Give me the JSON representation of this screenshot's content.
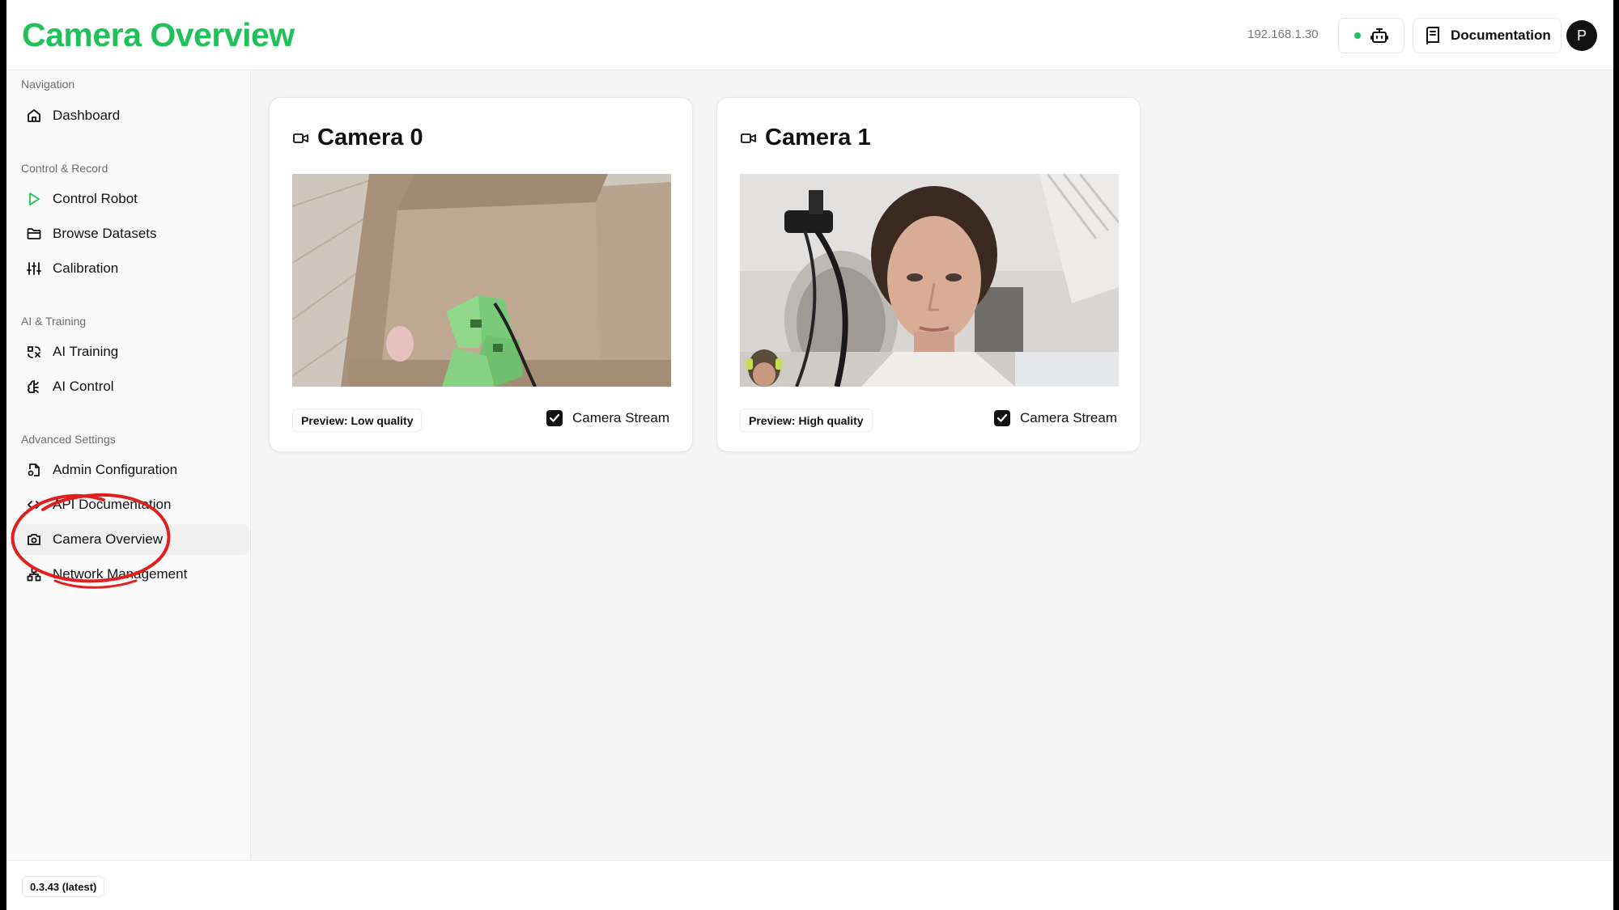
{
  "header": {
    "title": "Camera Overview",
    "ip": "192.168.1.30",
    "documentation_label": "Documentation",
    "avatar_initial": "P",
    "status_color": "#1fc158"
  },
  "sidebar": {
    "sections": [
      {
        "title": "Navigation",
        "items": [
          {
            "label": "Dashboard",
            "icon": "home-icon"
          }
        ]
      },
      {
        "title": "Control & Record",
        "items": [
          {
            "label": "Control Robot",
            "icon": "play-icon"
          },
          {
            "label": "Browse Datasets",
            "icon": "folder-icon"
          },
          {
            "label": "Calibration",
            "icon": "sliders-icon"
          }
        ]
      },
      {
        "title": "AI & Training",
        "items": [
          {
            "label": "AI Training",
            "icon": "brain-icon"
          },
          {
            "label": "AI Control",
            "icon": "brain-circuit-icon"
          }
        ]
      },
      {
        "title": "Advanced Settings",
        "items": [
          {
            "label": "Admin Configuration",
            "icon": "file-cog-icon"
          },
          {
            "label": "API Documentation",
            "icon": "code-icon"
          },
          {
            "label": "Camera Overview",
            "icon": "camera-icon",
            "active": true
          },
          {
            "label": "Network Management",
            "icon": "network-icon"
          }
        ]
      }
    ]
  },
  "cameras": [
    {
      "title": "Camera 0",
      "preview": "Preview: Low quality",
      "stream_label": "Camera Stream",
      "stream_enabled": true
    },
    {
      "title": "Camera 1",
      "preview": "Preview: High quality",
      "stream_label": "Camera Stream",
      "stream_enabled": true
    }
  ],
  "footer": {
    "version": "0.3.43 (latest)"
  },
  "colors": {
    "accent": "#1fc158",
    "annotation": "#e0201f"
  }
}
